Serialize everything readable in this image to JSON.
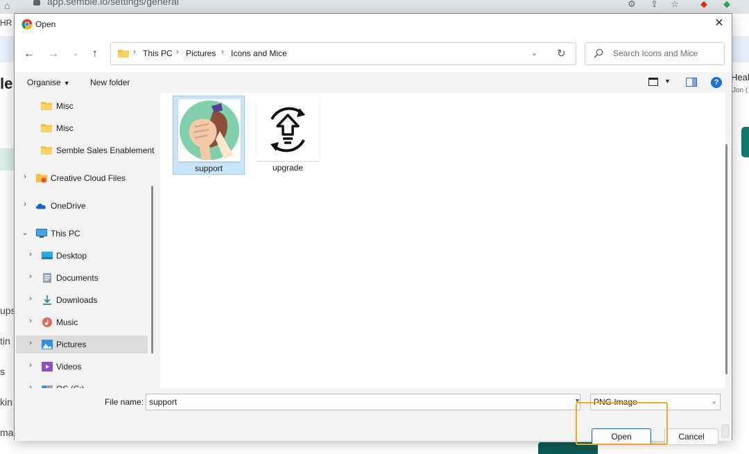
{
  "background": {
    "url": "app.semble.io/settings/general",
    "left_hr": "HR",
    "left_brand": "le",
    "side_fragments": [
      "ups",
      "tin",
      "s",
      "kin",
      "mai"
    ],
    "right_title": "Heal",
    "right_sub": "Jon (",
    "highlight_color": "#f5a623"
  },
  "dialog": {
    "title": "Open",
    "close_icon": "close-icon",
    "nav": {
      "back_icon": "arrow-left-icon",
      "forward_icon": "arrow-right-icon",
      "up_icon": "arrow-up-icon"
    },
    "breadcrumb": [
      "This PC",
      "Pictures",
      "Icons and Mice"
    ],
    "search_placeholder": "Search Icons and Mice",
    "toolbar": {
      "organise": "Organise",
      "new_folder": "New folder"
    },
    "tree": [
      {
        "label": "Misc",
        "icon": "folder-icon",
        "has_chevron": false,
        "expanded": false,
        "indent": 1
      },
      {
        "label": "Misc",
        "icon": "folder-icon",
        "has_chevron": false,
        "expanded": false,
        "indent": 1
      },
      {
        "label": "Semble Sales Enablement",
        "icon": "folder-icon",
        "has_chevron": false,
        "expanded": false,
        "indent": 1
      },
      {
        "label": "Creative Cloud Files",
        "icon": "creative-cloud-icon",
        "has_chevron": true,
        "expanded": false,
        "indent": 0
      },
      {
        "label": "OneDrive",
        "icon": "onedrive-icon",
        "has_chevron": true,
        "expanded": false,
        "indent": 0
      },
      {
        "label": "This PC",
        "icon": "this-pc-icon",
        "has_chevron": true,
        "expanded": true,
        "indent": 0
      },
      {
        "label": "Desktop",
        "icon": "desktop-icon",
        "has_chevron": true,
        "expanded": false,
        "indent": 1
      },
      {
        "label": "Documents",
        "icon": "documents-icon",
        "has_chevron": true,
        "expanded": false,
        "indent": 1
      },
      {
        "label": "Downloads",
        "icon": "downloads-icon",
        "has_chevron": true,
        "expanded": false,
        "indent": 1
      },
      {
        "label": "Music",
        "icon": "music-icon",
        "has_chevron": true,
        "expanded": false,
        "indent": 1
      },
      {
        "label": "Pictures",
        "icon": "pictures-icon",
        "has_chevron": true,
        "expanded": false,
        "indent": 1,
        "selected": true
      },
      {
        "label": "Videos",
        "icon": "videos-icon",
        "has_chevron": true,
        "expanded": false,
        "indent": 1
      },
      {
        "label": "OS (C:)",
        "icon": "drive-icon",
        "has_chevron": true,
        "expanded": false,
        "indent": 1
      }
    ],
    "files": [
      {
        "name": "support",
        "icon": "handshake-icon",
        "selected": true
      },
      {
        "name": "upgrade",
        "icon": "upgrade-arrow-icon",
        "selected": false
      }
    ],
    "footer": {
      "file_name_label": "File name:",
      "file_name_value": "support",
      "file_type": "PNG Image",
      "open_label": "Open",
      "cancel_label": "Cancel"
    }
  }
}
